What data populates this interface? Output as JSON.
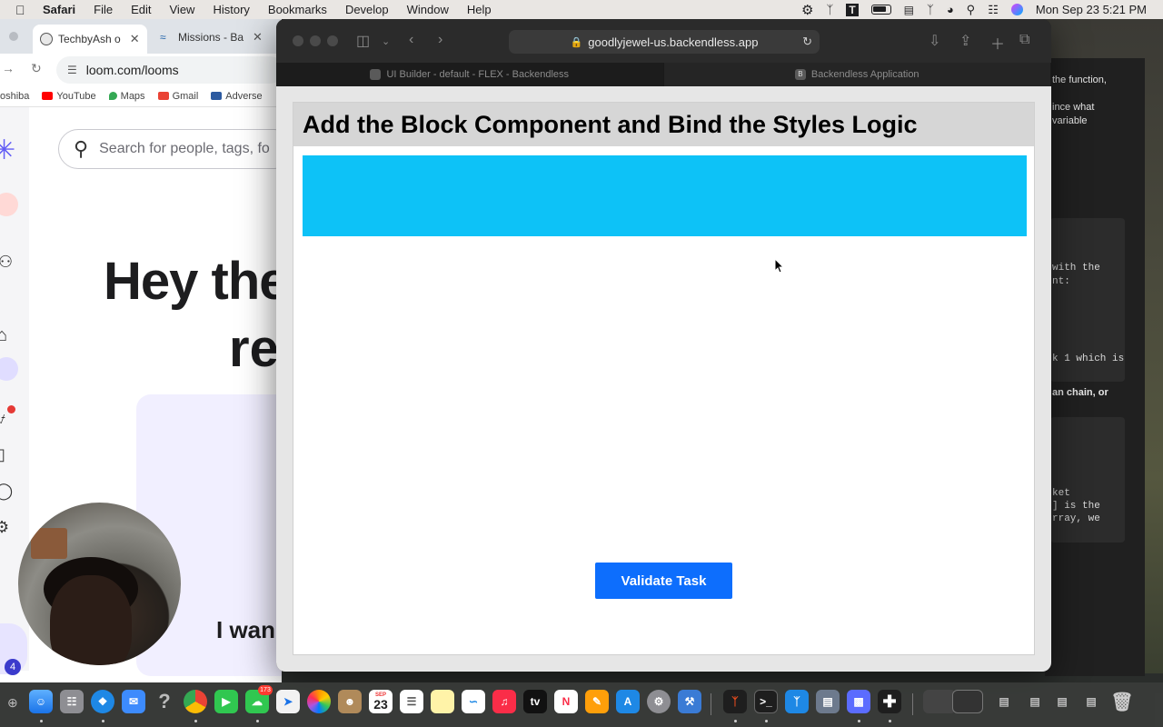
{
  "menubar": {
    "app_name": "Safari",
    "menus": [
      "File",
      "Edit",
      "View",
      "History",
      "Bookmarks",
      "Develop",
      "Window",
      "Help"
    ],
    "clock": "Mon Sep 23  5:21 PM"
  },
  "chrome": {
    "tabs": [
      {
        "label": "TechbyAsh o"
      },
      {
        "label": "Missions - Ba"
      }
    ],
    "address": "loom.com/looms",
    "bookmarks": [
      "oshiba",
      "YouTube",
      "Maps",
      "Gmail",
      "Adverse"
    ],
    "search_placeholder": "Search for people, tags, fo",
    "greeting_line1": "Hey the",
    "greeting_line2": "re",
    "cta_partial": "I wan",
    "notification_count": "4"
  },
  "safari": {
    "url": "goodlyjewel-us.backendless.app",
    "tabs": [
      {
        "label": "UI Builder - default - FLEX - Backendless",
        "active": true
      },
      {
        "label": "Backendless Application",
        "active": false,
        "favicon": "B"
      }
    ]
  },
  "app": {
    "title": "Add the Block Component and Bind the Styles Logic",
    "block_color": "#0dc2f7",
    "validate_button": "Validate Task",
    "button_color": "#0d6efd"
  },
  "doc_panel": {
    "lines": [
      {
        "text": "the function,",
        "style": "plain"
      },
      {
        "text": "ince what",
        "style": "plain"
      },
      {
        "text": "variable",
        "style": "plain"
      },
      {
        "text": "with the",
        "style": "mono"
      },
      {
        "text": "nt:",
        "style": "mono"
      },
      {
        "text": "k 1 which is",
        "style": "mono"
      },
      {
        "text": "an chain, or",
        "style": "bold"
      },
      {
        "text": "ket",
        "style": "mono"
      },
      {
        "text": "] is the",
        "style": "mono"
      },
      {
        "text": "rray, we",
        "style": "mono"
      }
    ]
  },
  "dock": {
    "calendar_month": "SEP",
    "calendar_day": "23",
    "messages_badge": "173"
  }
}
